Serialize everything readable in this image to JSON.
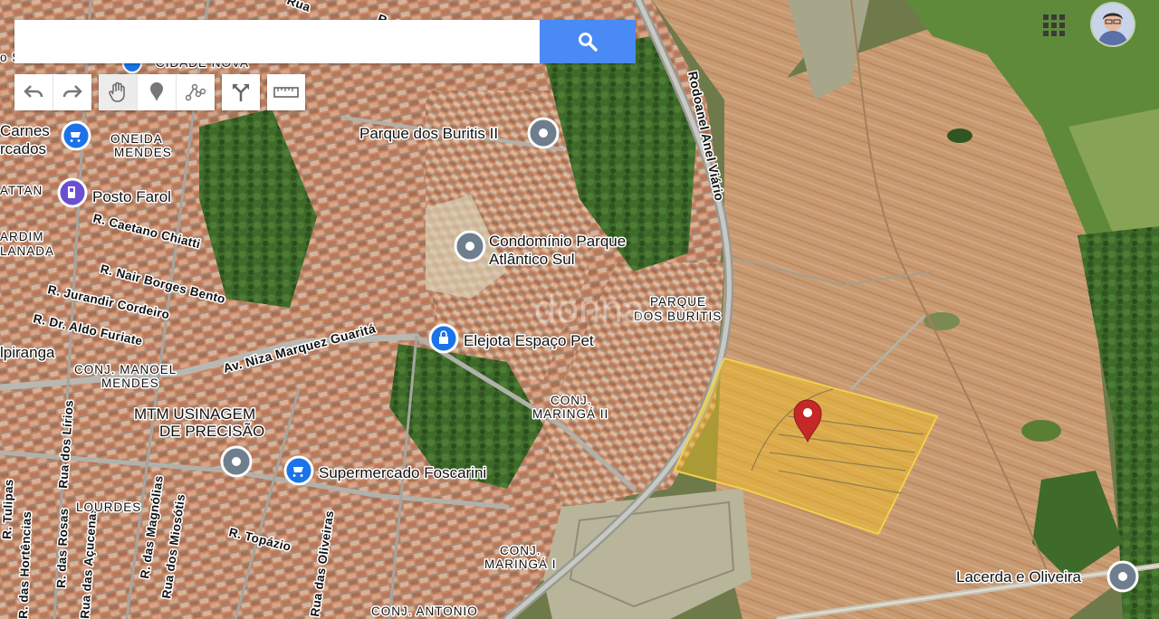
{
  "search": {
    "value": "",
    "placeholder": ""
  },
  "toolbar": {
    "undo_icon": "undo-icon",
    "redo_icon": "redo-icon",
    "pan_icon": "hand-icon",
    "placemark_icon": "placemark-icon",
    "path_icon": "path-icon",
    "directions_icon": "directions-icon",
    "ruler_icon": "ruler-icon"
  },
  "colors": {
    "search_button": "#4a8af4",
    "parcel_fill": "#f4c21c",
    "pin_red": "#c62828",
    "poi_blue": "#1a73e8",
    "poi_gray": "#6f7e8c"
  },
  "streets": [
    {
      "text": "R. Caetano Chiatti"
    },
    {
      "text": "R. Nair Borges Bento"
    },
    {
      "text": "R. Jurandir Cordeiro"
    },
    {
      "text": "R. Dr. Aldo Furiate"
    },
    {
      "text": "Av. Niza Marquez Guaritá"
    },
    {
      "text": "Rodoanel Anel Viário"
    },
    {
      "text": "R. Tulipas"
    },
    {
      "text": "Rua dos Lírios"
    },
    {
      "text": "R. das Rosas"
    },
    {
      "text": "R. das Hortências"
    },
    {
      "text": "Rua das Açucenas"
    },
    {
      "text": "R. das Magnólias"
    },
    {
      "text": "Rua dos Miosótis"
    },
    {
      "text": "R. Topázio"
    },
    {
      "text": "Rua das Oliveiras"
    },
    {
      "text": "R. Ca"
    },
    {
      "text": "Rua"
    }
  ],
  "pois": [
    {
      "text": "Carnes"
    },
    {
      "text": "rcados"
    },
    {
      "text": "Posto Farol"
    },
    {
      "text": "Parque dos Buritis II"
    },
    {
      "text": "Condomínio Parque"
    },
    {
      "text": "Atlântico Sul"
    },
    {
      "text": "Elejota Espaço Pet"
    },
    {
      "text": "MTM USINAGEM"
    },
    {
      "text": "DE PRECISÃO"
    },
    {
      "text": "Supermercado Foscarini"
    },
    {
      "text": "Lacerda e Oliveira"
    },
    {
      "text": "lpiranga"
    }
  ],
  "areas": [
    {
      "text": "ONEIDA"
    },
    {
      "text": "MENDES"
    },
    {
      "text": "ATTAN"
    },
    {
      "text": "ARDIM"
    },
    {
      "text": "LANADA"
    },
    {
      "text": "CONJ. MANOEL"
    },
    {
      "text": "MENDES"
    },
    {
      "text": "PARQUE"
    },
    {
      "text": "DOS BURITIS"
    },
    {
      "text": "CONJ."
    },
    {
      "text": "MARINGÁ II"
    },
    {
      "text": "CONJ."
    },
    {
      "text": "MARINGÁ I"
    },
    {
      "text": "LOURDES"
    },
    {
      "text": "CONJ. ANTONIO"
    },
    {
      "text": "CIDADE NOVA"
    },
    {
      "text": "o S"
    }
  ],
  "watermark": "donna"
}
